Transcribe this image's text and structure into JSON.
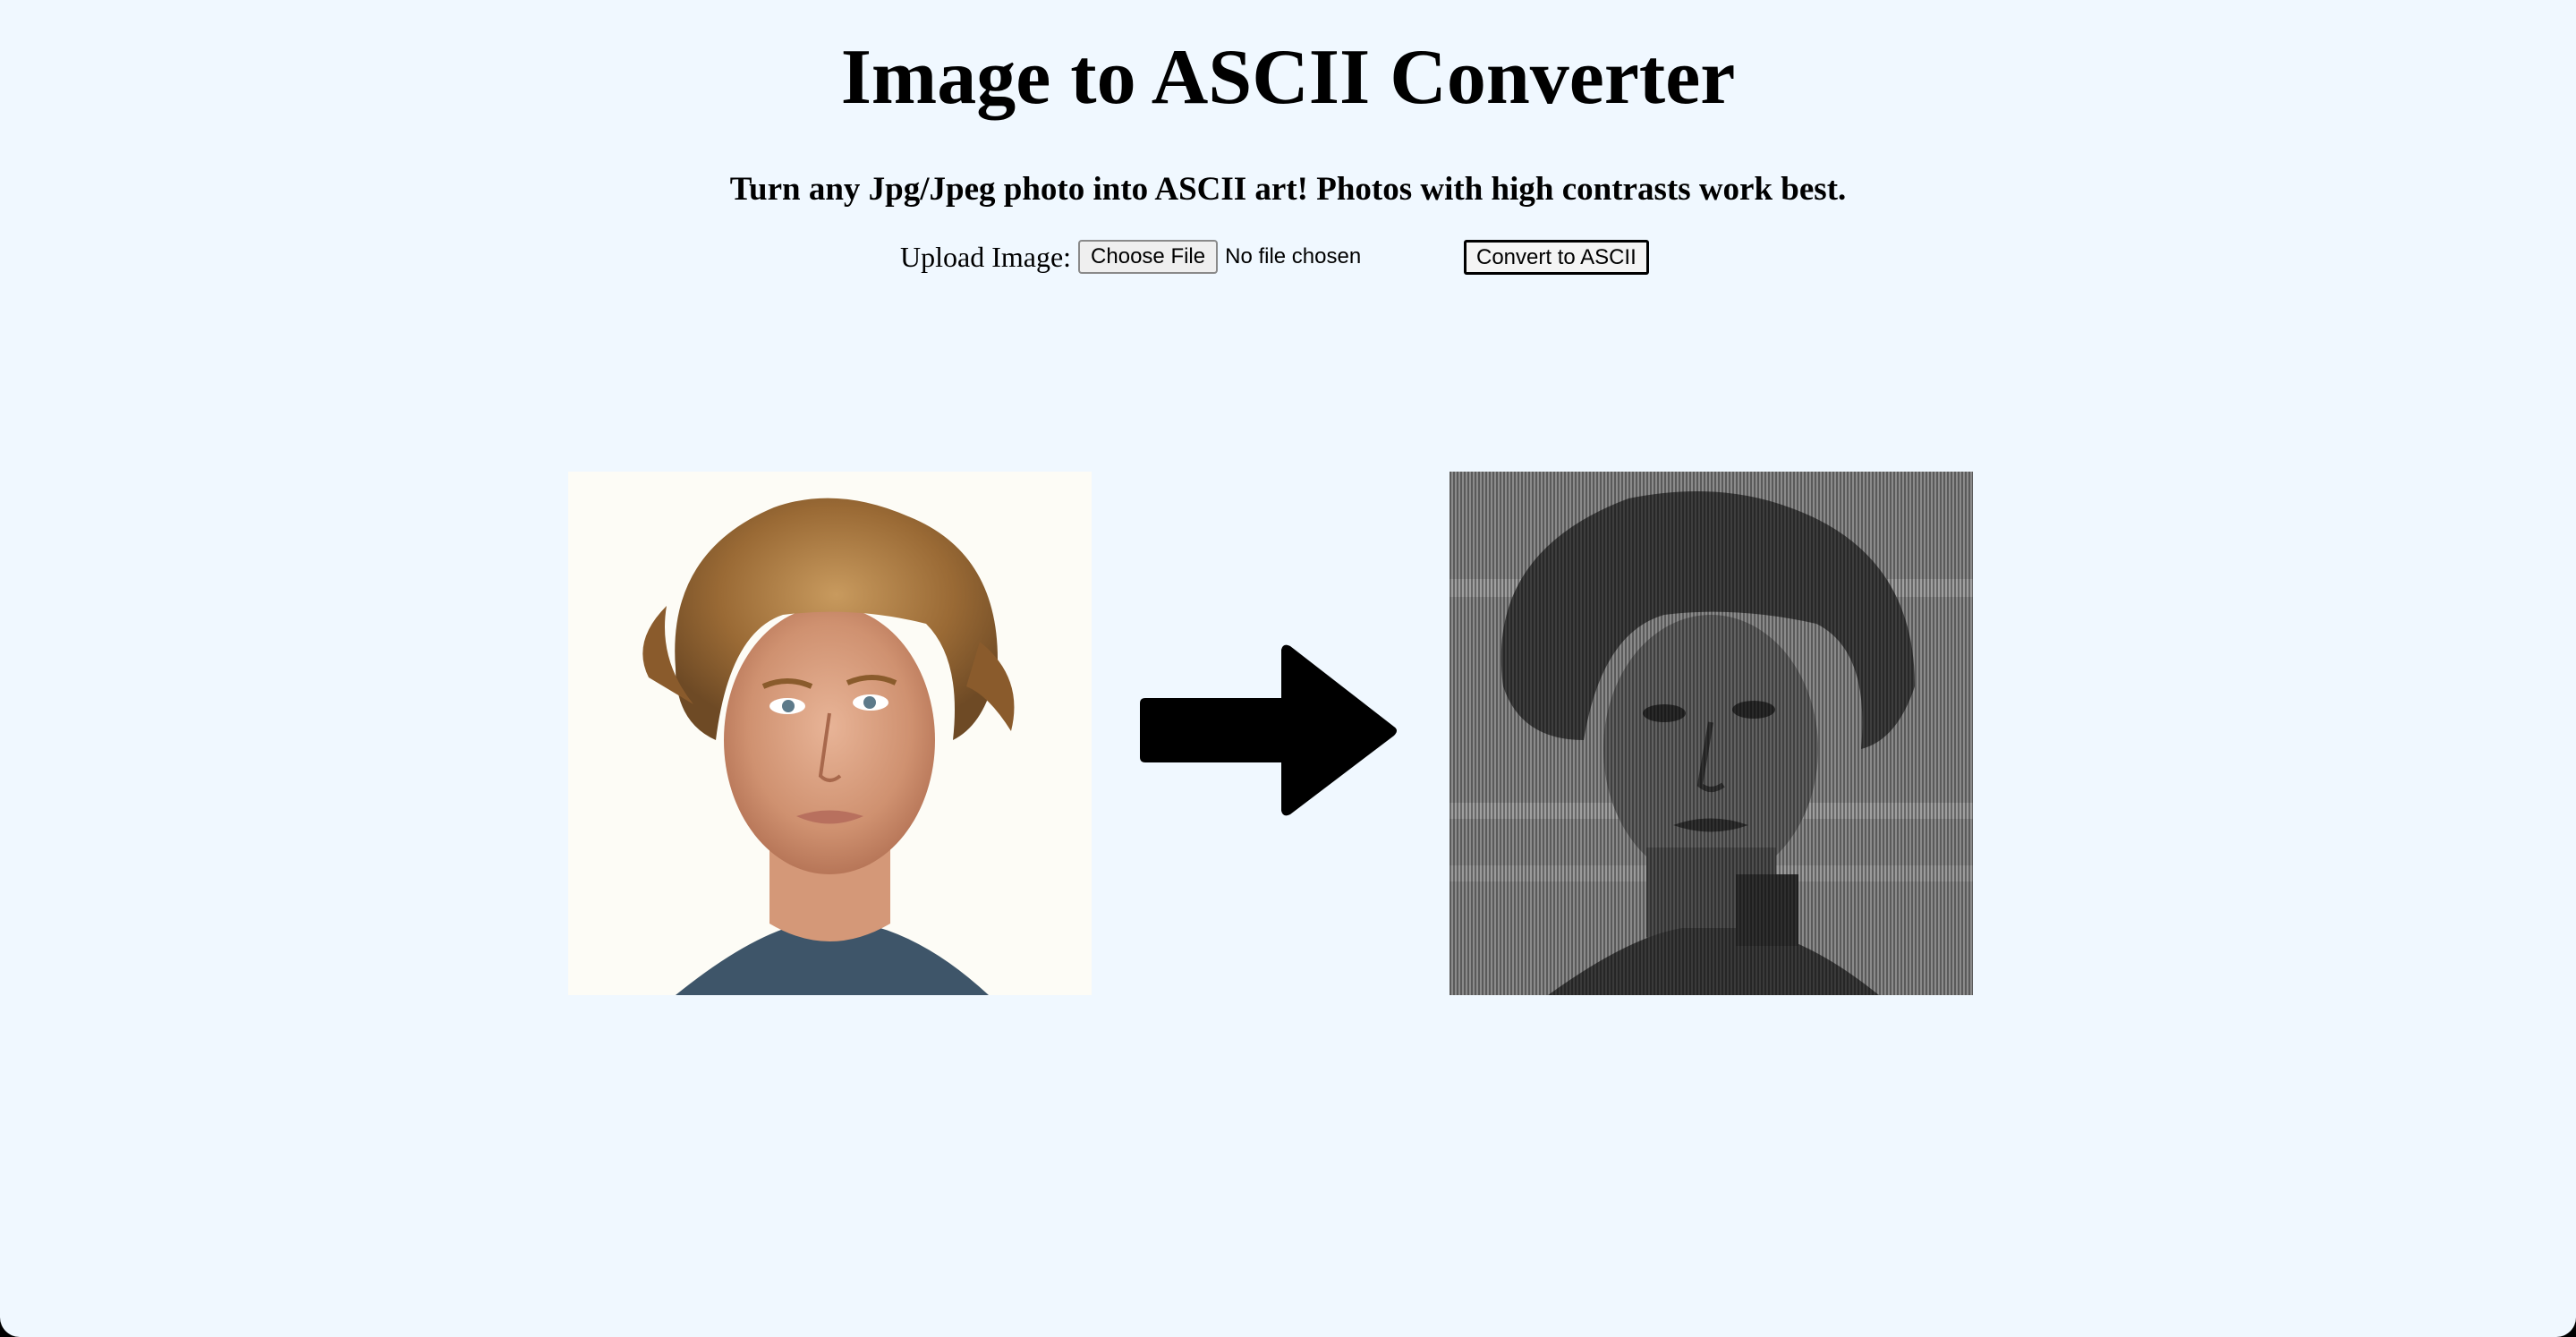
{
  "page": {
    "title": "Image to ASCII Converter",
    "subtitle": "Turn any Jpg/Jpeg photo into ASCII art! Photos with high contrasts work best."
  },
  "upload": {
    "label": "Upload Image:",
    "choose_button": "Choose File",
    "file_status": "No file chosen"
  },
  "convert_button": "Convert to ASCII",
  "preview": {
    "original_image": "portrait-photo",
    "arrow_icon": "right-arrow-icon",
    "ascii_image": "ascii-art-portrait"
  },
  "colors": {
    "background": "#f0f8ff",
    "arrow": "#000000",
    "ascii_tone": "#7a7a7a"
  }
}
